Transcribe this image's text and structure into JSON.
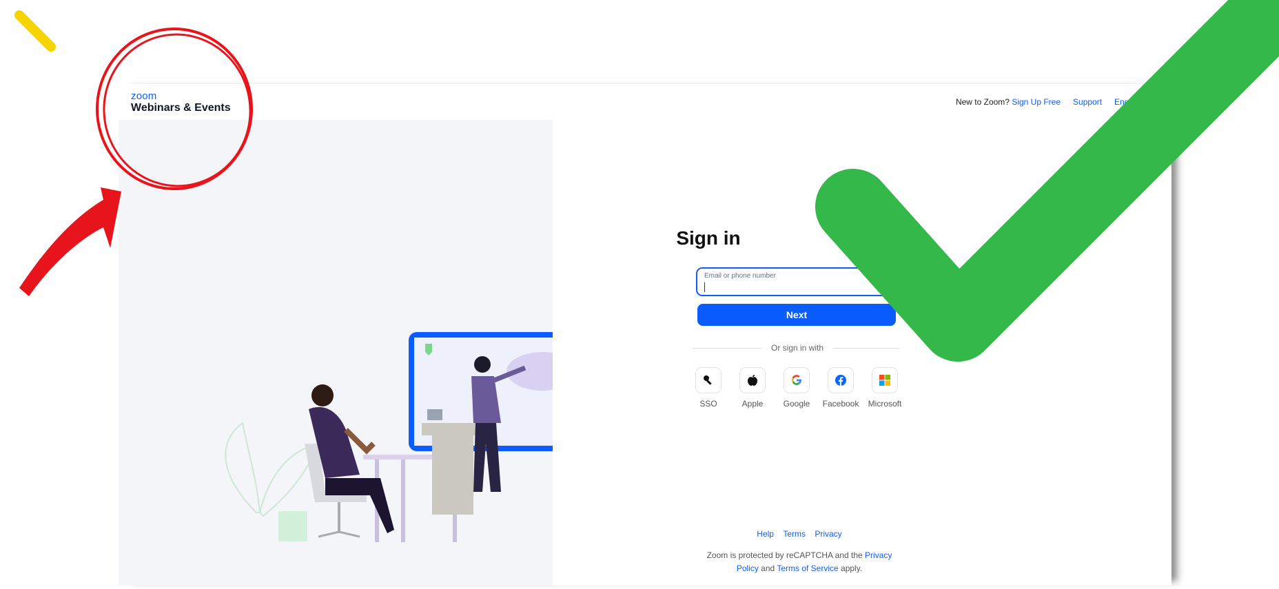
{
  "brand": {
    "logo_text": "zoom",
    "product": "Webinars & Events"
  },
  "topnav": {
    "new_to_zoom": "New to Zoom?",
    "sign_up": "Sign Up Free",
    "support": "Support",
    "language": "English"
  },
  "signin": {
    "title": "Sign in",
    "email_placeholder": "Email or phone number",
    "next_label": "Next",
    "or_text": "Or sign in with"
  },
  "providers": [
    {
      "label": "SSO",
      "icon": "key-icon"
    },
    {
      "label": "Apple",
      "icon": "apple-icon"
    },
    {
      "label": "Google",
      "icon": "google-icon"
    },
    {
      "label": "Facebook",
      "icon": "facebook-icon"
    },
    {
      "label": "Microsoft",
      "icon": "microsoft-icon"
    }
  ],
  "footer": {
    "help": "Help",
    "terms": "Terms",
    "privacy": "Privacy",
    "captcha_pre": "Zoom is protected by reCAPTCHA and the",
    "captcha_privacy": "Privacy Policy",
    "captcha_and": "and",
    "captcha_terms": "Terms of Service",
    "captcha_post": "apply."
  },
  "colors": {
    "brand_blue": "#0b5cff",
    "annotation_red": "#e8141c",
    "annotation_green": "#34b84a",
    "annotation_yellow": "#f5d400"
  }
}
